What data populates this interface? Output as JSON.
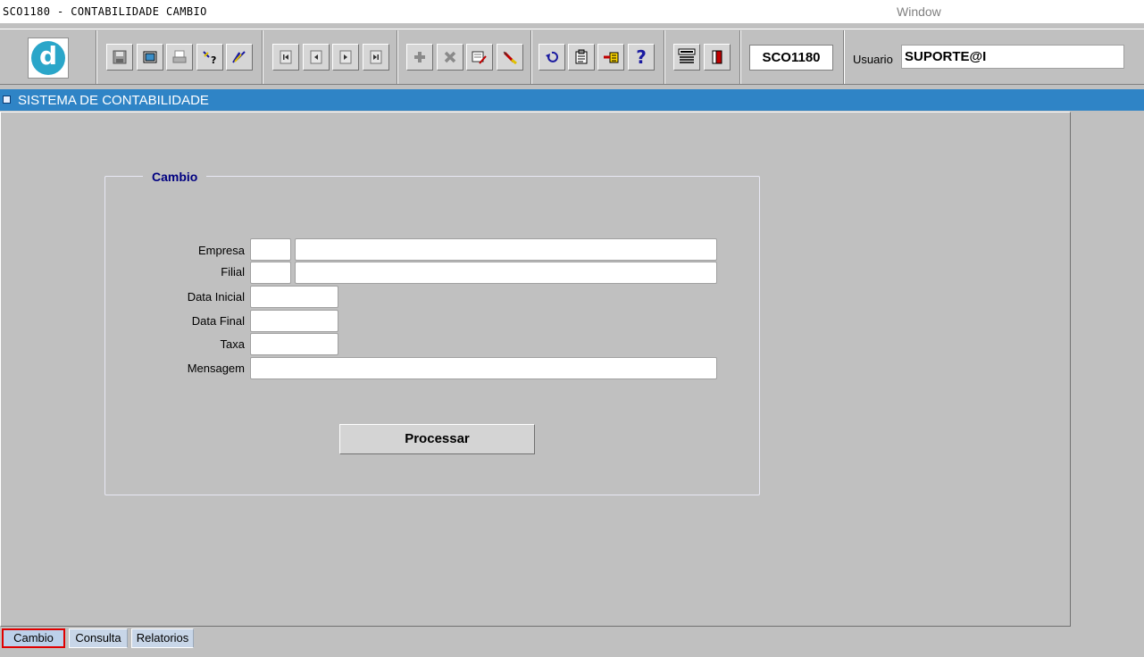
{
  "window": {
    "title": "SCO1180 - CONTABILIDADE CAMBIO",
    "menu": "Window"
  },
  "toolbar": {
    "logo_letter": "d",
    "buttons": [
      "save-icon",
      "window-icon",
      "print-icon",
      "query-help-icon",
      "execute-query-icon",
      "first-record-icon",
      "previous-record-icon",
      "next-record-icon",
      "last-record-icon",
      "insert-record-icon",
      "delete-record-icon",
      "edit-record-icon",
      "clear-icon",
      "undo-icon",
      "clipboard-icon",
      "lov-icon",
      "help-icon",
      "menu-icon",
      "exit-icon"
    ],
    "form_code": "SCO1180",
    "usuario_label": "Usuario",
    "usuario_value": "SUPORTE@I"
  },
  "section": {
    "title": "SISTEMA DE CONTABILIDADE"
  },
  "form": {
    "frame_title": "Cambio",
    "labels": {
      "empresa": "Empresa",
      "filial": "Filial",
      "data_inicial": "Data Inicial",
      "data_final": "Data Final",
      "taxa": "Taxa",
      "mensagem": "Mensagem"
    },
    "values": {
      "empresa_code": "",
      "empresa_name": "",
      "filial_code": "",
      "filial_name": "",
      "data_inicial": "",
      "data_final": "",
      "taxa": "",
      "mensagem": ""
    },
    "processar_label": "Processar"
  },
  "tabs": [
    {
      "label": "Cambio",
      "active": true
    },
    {
      "label": "Consulta",
      "active": false
    },
    {
      "label": "Relatorios",
      "active": false
    }
  ],
  "colors": {
    "section_bar": "#2f84c6",
    "frame_title": "#000080",
    "active_tab_border": "#e00000",
    "logo": "#2aa6c9"
  }
}
